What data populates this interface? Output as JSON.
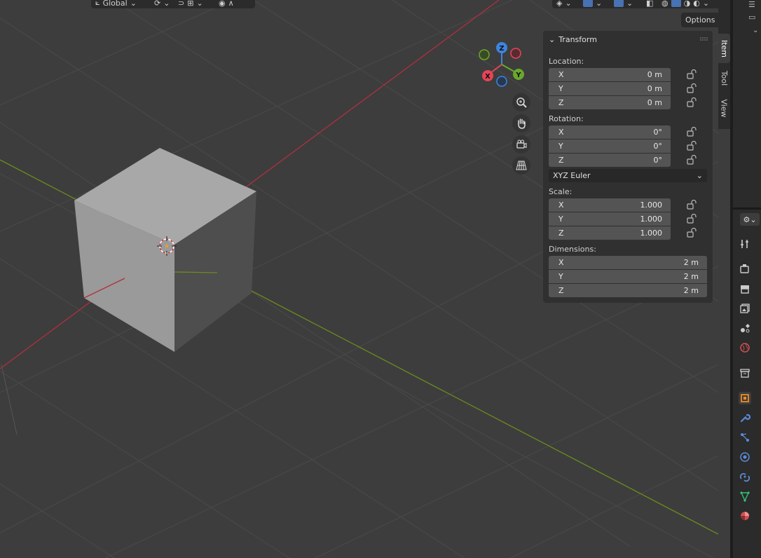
{
  "header": {
    "orientation_label": "Global",
    "options_label": "Options"
  },
  "gizmo": {
    "z": "Z",
    "y": "Y",
    "x": "X",
    "colors": {
      "x": "#e64558",
      "y": "#6aa82b",
      "z": "#3d85e0"
    }
  },
  "viewport_tools": [
    "zoom-icon",
    "pan-hand-icon",
    "camera-icon",
    "grid-perspective-icon"
  ],
  "transform": {
    "title": "Transform",
    "location": {
      "label": "Location:",
      "x_label": "X",
      "x": "0 m",
      "y_label": "Y",
      "y": "0 m",
      "z_label": "Z",
      "z": "0 m"
    },
    "rotation": {
      "label": "Rotation:",
      "x_label": "X",
      "x": "0°",
      "y_label": "Y",
      "y": "0°",
      "z_label": "Z",
      "z": "0°"
    },
    "rotation_mode": "XYZ Euler",
    "scale": {
      "label": "Scale:",
      "x_label": "X",
      "x": "1.000",
      "y_label": "Y",
      "y": "1.000",
      "z_label": "Z",
      "z": "1.000"
    },
    "dimensions": {
      "label": "Dimensions:",
      "x_label": "X",
      "x": "2 m",
      "y_label": "Y",
      "y": "2 m",
      "z_label": "Z",
      "z": "2 m"
    }
  },
  "tabs": {
    "item": "Item",
    "tool": "Tool",
    "view": "View"
  },
  "properties_icons": [
    "tool-icon",
    "render-icon",
    "output-icon",
    "view-layer-icon",
    "scene-icon",
    "world-icon",
    "collection-icon",
    "object-icon",
    "modifier-icon",
    "particles-icon",
    "physics-icon",
    "constraints-icon",
    "data-icon",
    "material-icon"
  ]
}
